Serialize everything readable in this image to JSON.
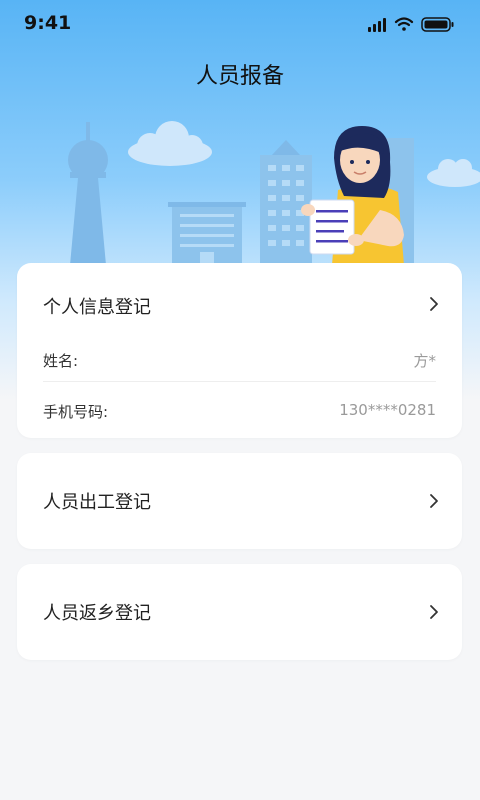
{
  "status_bar": {
    "time": "9:41"
  },
  "header": {
    "title": "人员报备"
  },
  "personal_info": {
    "title": "个人信息登记",
    "name_label": "姓名:",
    "name_value": "方*",
    "phone_label": "手机号码:",
    "phone_value": "130****0281"
  },
  "menu": [
    {
      "label": "人员出工登记"
    },
    {
      "label": "人员返乡登记"
    }
  ],
  "colors": {
    "hero_top": "#58b4f5",
    "background": "#f5f6f8",
    "accent_yellow": "#f7c531"
  }
}
